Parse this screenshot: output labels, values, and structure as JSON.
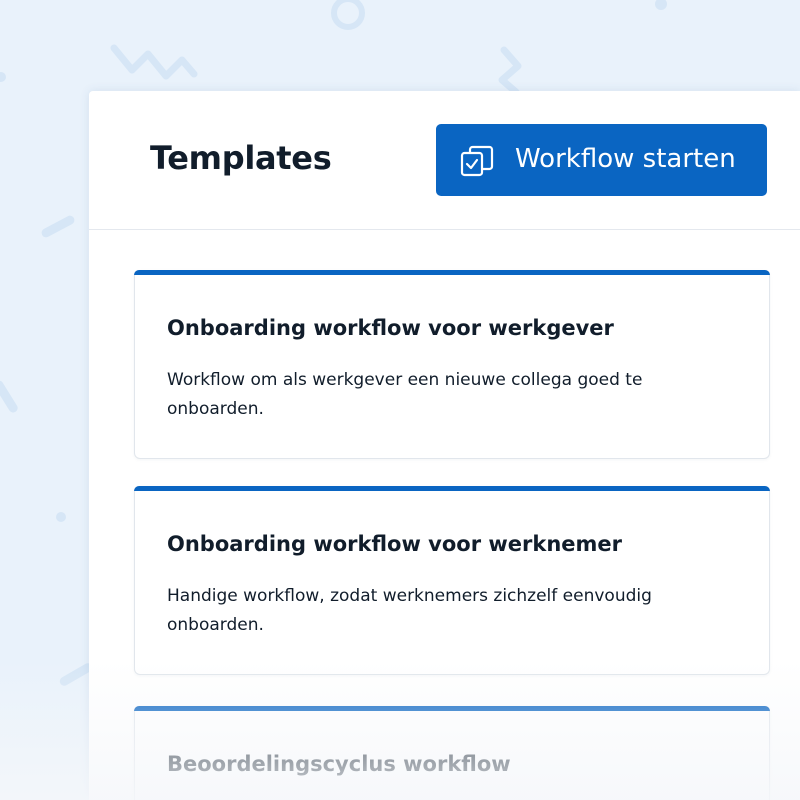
{
  "header": {
    "title": "Templates",
    "start_button_label": "Workflow starten",
    "start_button_icon": "copy-check-icon"
  },
  "templates": [
    {
      "title": "Onboarding workflow voor werkgever",
      "description": "Workflow om als werkgever een nieuwe collega goed te onboarden."
    },
    {
      "title": "Onboarding workflow voor werknemer",
      "description": "Handige workflow, zodat werknemers zichzelf eenvoudig onboarden."
    },
    {
      "title": "Beoordelingscyclus workflow",
      "description": ""
    }
  ],
  "colors": {
    "accent": "#0a65c2",
    "background": "#e9f2fb",
    "text": "#111d2b"
  }
}
